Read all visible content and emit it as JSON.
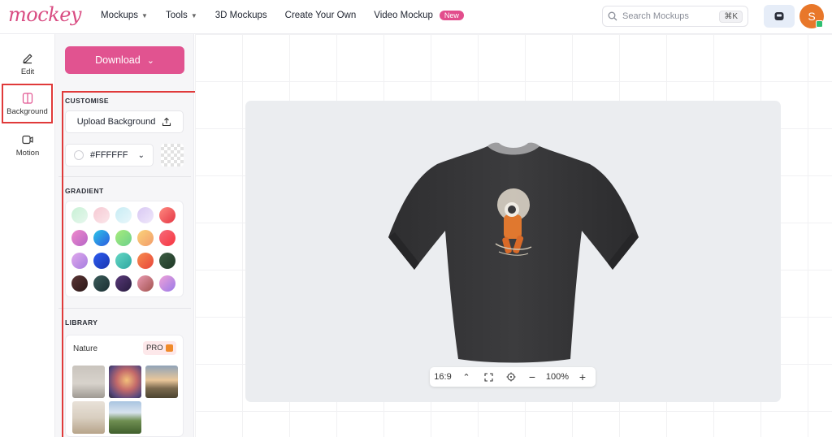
{
  "brand": {
    "logo_text": "mockey",
    "accent": "#e15390"
  },
  "nav": {
    "items": [
      {
        "label": "Mockups",
        "dropdown": true
      },
      {
        "label": "Tools",
        "dropdown": true
      },
      {
        "label": "3D Mockups",
        "dropdown": false
      },
      {
        "label": "Create Your Own",
        "dropdown": false
      },
      {
        "label": "Video Mockup",
        "dropdown": false
      }
    ],
    "new_badge": "New"
  },
  "search": {
    "placeholder": "Search Mockups",
    "shortcut": "⌘K"
  },
  "user": {
    "initial": "S",
    "avatar_color": "#e8772a"
  },
  "rail": {
    "items": [
      {
        "label": "Edit",
        "icon": "pencil-icon"
      },
      {
        "label": "Background",
        "icon": "background-icon",
        "active": true
      },
      {
        "label": "Motion",
        "icon": "motion-icon"
      }
    ]
  },
  "panel": {
    "download_label": "Download",
    "customise_title": "CUSTOMISE",
    "upload_label": "Upload Background",
    "color_value": "#FFFFFF",
    "gradient_title": "GRADIENT",
    "gradients": [
      [
        "#c8f1d5",
        "#e7f7ee"
      ],
      [
        "#f6c9d3",
        "#fbe6ea"
      ],
      [
        "#c7ecf4",
        "#e9f7fb"
      ],
      [
        "#d8c8f3",
        "#f0e8fb"
      ],
      [
        "#ff8a80",
        "#e43745"
      ],
      [
        "#f08acb",
        "#b665c7"
      ],
      [
        "#2cc6e8",
        "#2d5be0"
      ],
      [
        "#a8ec7a",
        "#6cd18c"
      ],
      [
        "#fbd37a",
        "#f29c6b"
      ],
      [
        "#f56b7b",
        "#f7353f"
      ],
      [
        "#e0a8ec",
        "#a67de0"
      ],
      [
        "#2d5cf0",
        "#1a35b0"
      ],
      [
        "#64d7c4",
        "#2fa7a1"
      ],
      [
        "#f78d4f",
        "#e8453b"
      ],
      [
        "#3e5e45",
        "#1f3826"
      ],
      [
        "#5b3535",
        "#2a1717"
      ],
      [
        "#3b5c5a",
        "#1b2f33"
      ],
      [
        "#5a3a7a",
        "#271b3e"
      ],
      [
        "#e99ab1",
        "#a3534f"
      ],
      [
        "#f0a2d8",
        "#9a7ae8"
      ]
    ],
    "library_title": "LIBRARY",
    "library": {
      "category": "Nature",
      "pro_label": "PRO",
      "thumbnails": [
        "room-thumb",
        "sunset-thumb",
        "field-thumb",
        "interior-thumb",
        "hill-thumb"
      ]
    }
  },
  "canvas": {
    "product": "t-shirt",
    "aspect_ratio": "16:9",
    "zoom": "100%"
  }
}
